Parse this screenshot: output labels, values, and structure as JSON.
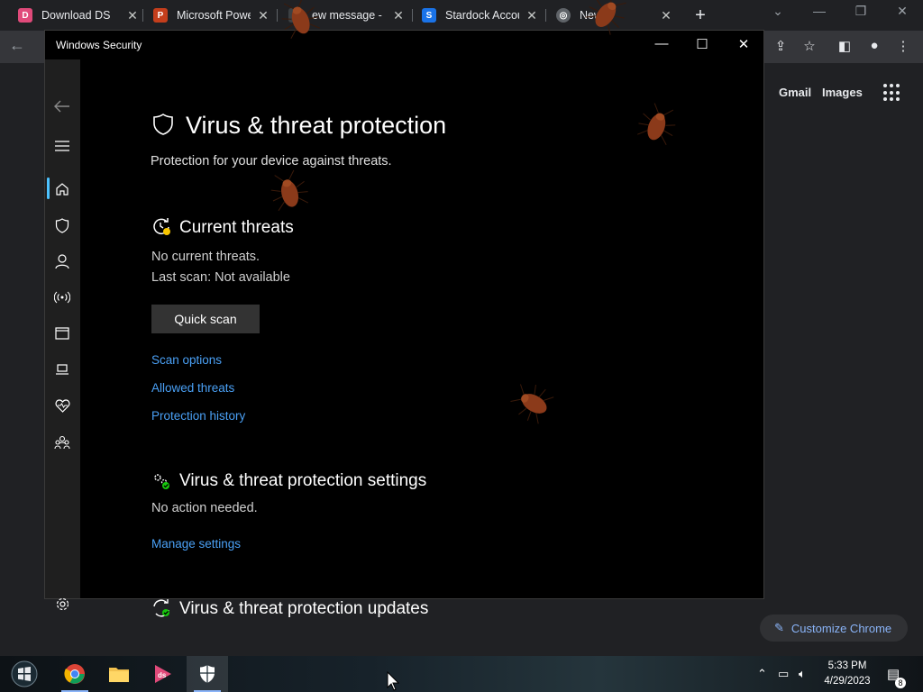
{
  "browser": {
    "tabs": [
      {
        "title": "Download DS",
        "favicon_color": "#e04a7a"
      },
      {
        "title": "Microsoft Powe",
        "favicon_color": "#c43e1c"
      },
      {
        "title": "ew message -",
        "favicon_color": "#3c4043"
      },
      {
        "title": "Stardock Accou",
        "favicon_color": "#1a73e8"
      },
      {
        "title": "New",
        "favicon_color": "#8ab4f8"
      }
    ],
    "new_tab_label": "+",
    "links": {
      "gmail": "Gmail",
      "images": "Images"
    },
    "customize_label": "Customize Chrome"
  },
  "window": {
    "title": "Windows Security",
    "controls": {
      "minimize": "—",
      "maximize": "☐",
      "close": "✕"
    }
  },
  "nav": {
    "items": [
      "back-icon",
      "menu-icon",
      "home-icon",
      "shield-icon",
      "account-icon",
      "firewall-icon",
      "app-browser-icon",
      "device-security-icon",
      "health-icon",
      "family-icon",
      "settings-icon"
    ]
  },
  "page": {
    "title": "Virus & threat protection",
    "subtitle": "Protection for your device against threats.",
    "current_threats": {
      "title": "Current threats",
      "status": "No current threats.",
      "last_scan": "Last scan: Not available",
      "button": "Quick scan",
      "links": [
        "Scan options",
        "Allowed threats",
        "Protection history"
      ]
    },
    "settings": {
      "title": "Virus & threat protection settings",
      "status": "No action needed.",
      "link": "Manage settings"
    },
    "updates": {
      "title": "Virus & threat protection updates"
    }
  },
  "taskbar": {
    "apps": [
      "start-icon",
      "chrome-icon",
      "file-explorer-icon",
      "ds-app-icon",
      "windows-security-icon"
    ],
    "time": "5:33 PM",
    "date": "4/29/2023",
    "notifications": "8"
  },
  "colors": {
    "accent_link": "#4aa0f5",
    "nav_indicator": "#4cc2ff",
    "status_green": "#16c60c"
  }
}
